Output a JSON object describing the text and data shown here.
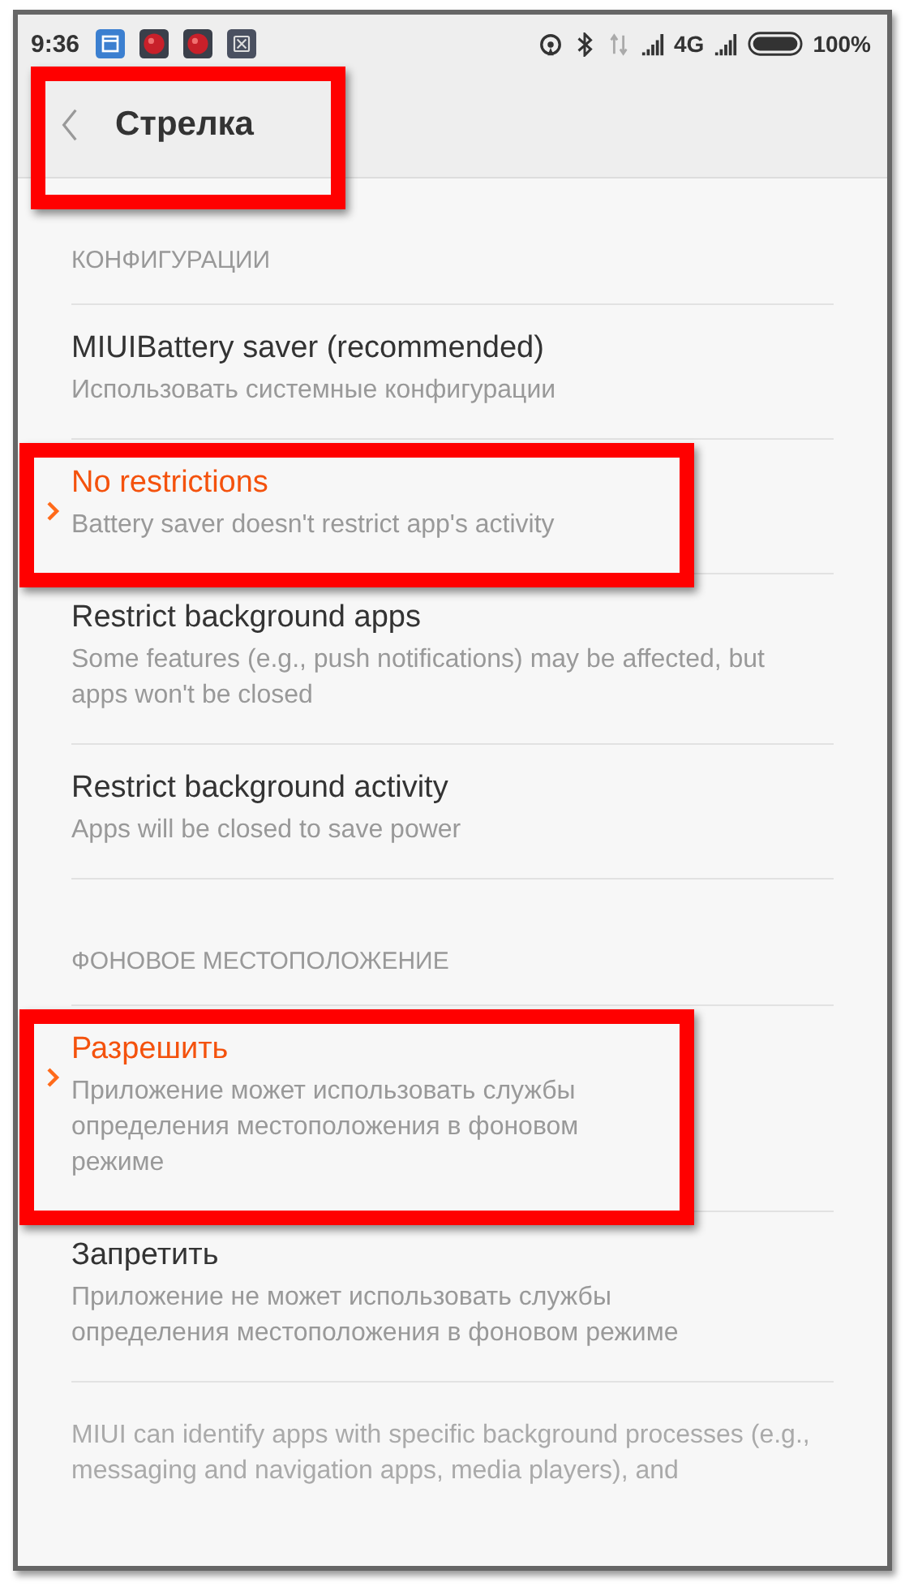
{
  "status_bar": {
    "time": "9:36",
    "network": "4G",
    "battery": "100%"
  },
  "header": {
    "title": "Стрелка",
    "highlighted": true
  },
  "sections": [
    {
      "title": "КОНФИГУРАЦИИ",
      "options": [
        {
          "title": "MIUIBattery saver (recommended)",
          "subtitle": "Использовать системные конфигурации",
          "selected": false
        },
        {
          "title": "No restrictions",
          "subtitle": "Battery saver doesn't restrict app's activity",
          "selected": true
        },
        {
          "title": "Restrict background apps",
          "subtitle": "Some features (e.g., push notifications) may be affected, but apps won't be closed",
          "selected": false
        },
        {
          "title": "Restrict background activity",
          "subtitle": "Apps will be closed to save power",
          "selected": false
        }
      ]
    },
    {
      "title": "ФОНОВОЕ МЕСТОПОЛОЖЕНИЕ",
      "options": [
        {
          "title": "Разрешить",
          "subtitle": "Приложение может использовать службы определения местоположения в фоновом режиме",
          "selected": true
        },
        {
          "title": "Запретить",
          "subtitle": "Приложение не может использовать службы определения местоположения в фоновом режиме",
          "selected": false
        }
      ]
    }
  ],
  "footer_note": "MIUI can identify apps with specific background processes (e.g., messaging and navigation apps, media players), and"
}
